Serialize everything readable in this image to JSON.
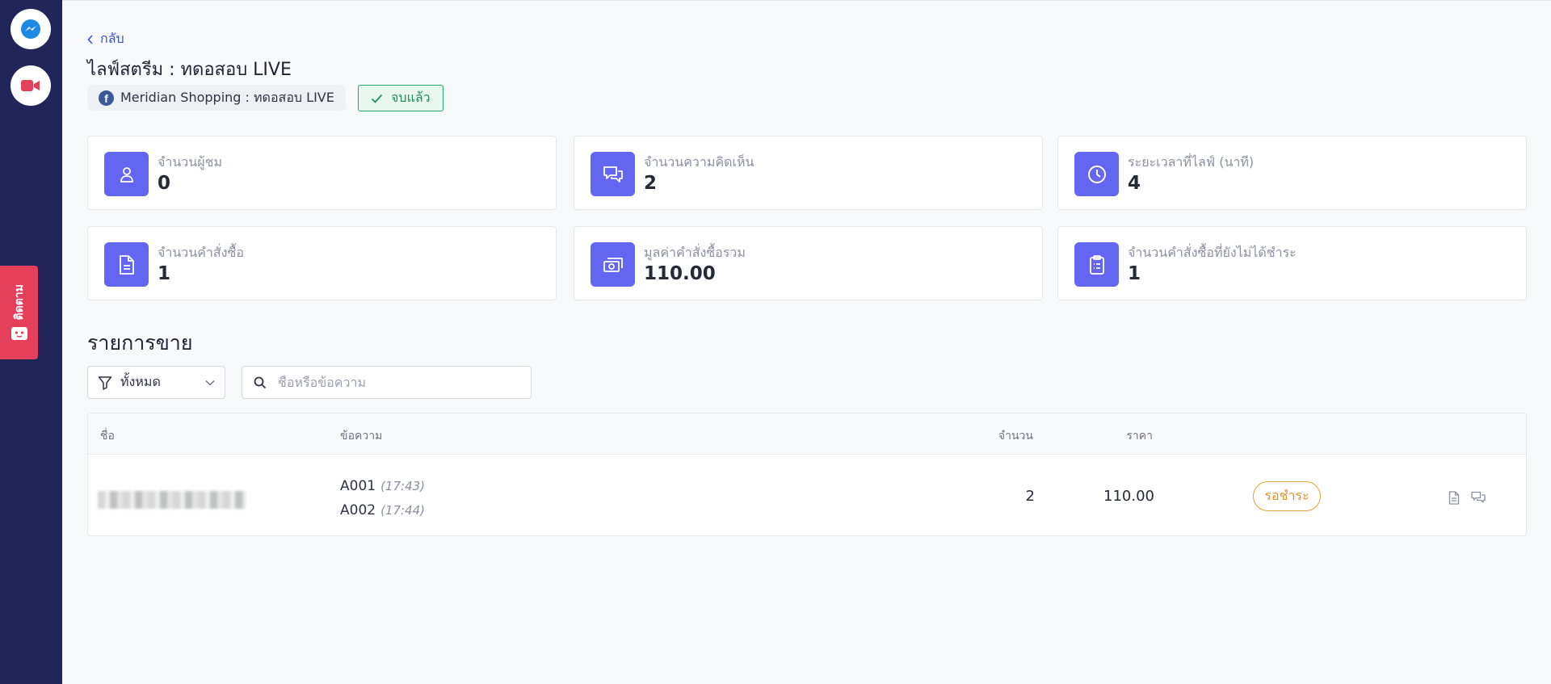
{
  "rail": {
    "icons": [
      "messenger-icon",
      "video-camera-icon"
    ],
    "feedback_label": "ติดตาม"
  },
  "header": {
    "back_label": "กลับ",
    "title": "ไลฟ์สตรีม : ทดอสอบ LIVE",
    "page_chip": "Meridian Shopping : ทดอสอบ LIVE",
    "status": "จบแล้ว"
  },
  "stats": [
    {
      "label": "จำนวนผู้ชม",
      "value": "0",
      "icon": "user-icon"
    },
    {
      "label": "จำนวนความคิดเห็น",
      "value": "2",
      "icon": "comments-icon"
    },
    {
      "label": "ระยะเวลาที่ไลฟ์ (นาที)",
      "value": "4",
      "icon": "clock-icon"
    },
    {
      "label": "จำนวนคำสั่งซื้อ",
      "value": "1",
      "icon": "document-icon"
    },
    {
      "label": "มูลค่าคำสั่งซื้อรวม",
      "value": "110.00",
      "icon": "cash-icon"
    },
    {
      "label": "จำนวนคำสั่งซื้อที่ยังไม่ได้ชำระ",
      "value": "1",
      "icon": "clipboard-icon"
    }
  ],
  "sales": {
    "title": "รายการขาย",
    "filter_value": "ทั้งหมด",
    "search_placeholder": "ชื่อหรือข้อความ",
    "columns": {
      "name": "ชื่อ",
      "message": "ข้อความ",
      "quantity": "จำนวน",
      "price": "ราคา"
    },
    "rows": [
      {
        "messages": [
          {
            "code": "A001",
            "time": "(17:43)"
          },
          {
            "code": "A002",
            "time": "(17:44)"
          }
        ],
        "quantity": "2",
        "price": "110.00",
        "status": "รอชำระ"
      }
    ]
  },
  "colors": {
    "accent": "#6366f1",
    "rail": "#22255a",
    "success": "#27a06a",
    "pending": "#e0a33b",
    "link": "#3b4fd6"
  }
}
